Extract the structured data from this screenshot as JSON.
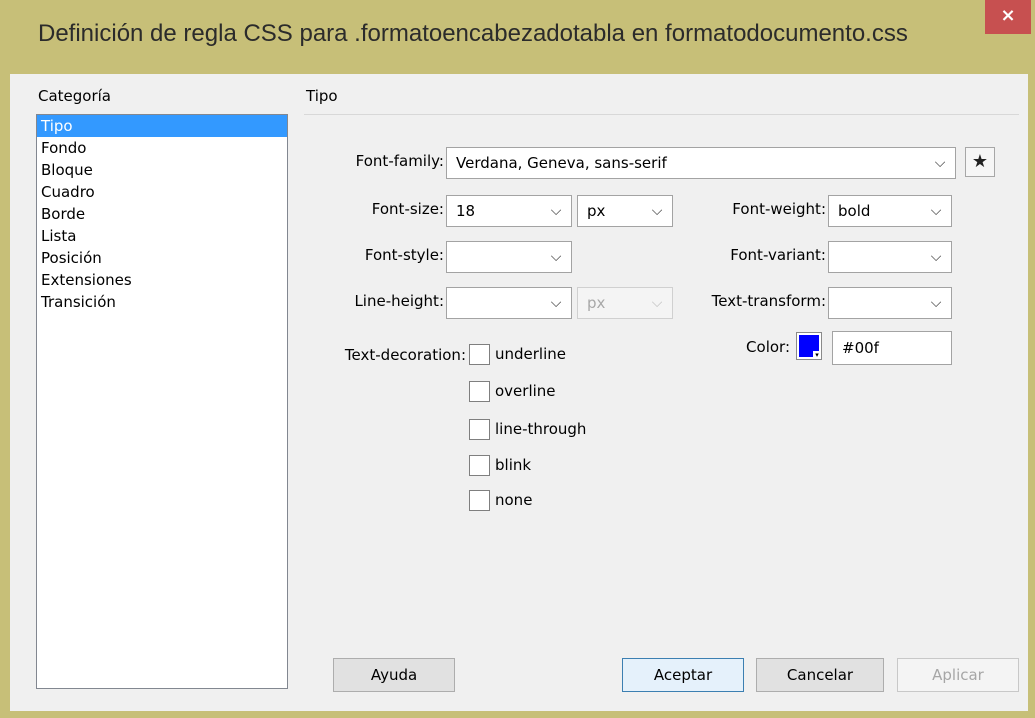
{
  "window": {
    "title": "Definición de regla CSS para .formatoencabezadotabla en formatodocumento.css",
    "close_glyph": "×"
  },
  "categories": {
    "label": "Categoría",
    "items": [
      "Tipo",
      "Fondo",
      "Bloque",
      "Cuadro",
      "Borde",
      "Lista",
      "Posición",
      "Extensiones",
      "Transición"
    ],
    "selected": "Tipo"
  },
  "panel": {
    "heading": "Tipo",
    "font_family": {
      "label": "Font-family:",
      "value": "Verdana, Geneva, sans-serif"
    },
    "font_size": {
      "label": "Font-size:",
      "value": "18",
      "unit": "px"
    },
    "font_weight": {
      "label": "Font-weight:",
      "value": "bold"
    },
    "font_style": {
      "label": "Font-style:",
      "value": ""
    },
    "font_variant": {
      "label": "Font-variant:",
      "value": ""
    },
    "line_height": {
      "label": "Line-height:",
      "value": "",
      "unit": "px"
    },
    "text_transform": {
      "label": "Text-transform:",
      "value": ""
    },
    "text_decoration": {
      "label": "Text-decoration:",
      "options": [
        "underline",
        "overline",
        "line-through",
        "blink",
        "none"
      ]
    },
    "color": {
      "label": "Color:",
      "value": "#00f",
      "swatch": "#0000ff"
    }
  },
  "buttons": {
    "help": "Ayuda",
    "ok": "Aceptar",
    "cancel": "Cancelar",
    "apply": "Aplicar"
  },
  "icons": {
    "dropdown": "chevron-down-icon",
    "favorite": "star-icon"
  }
}
